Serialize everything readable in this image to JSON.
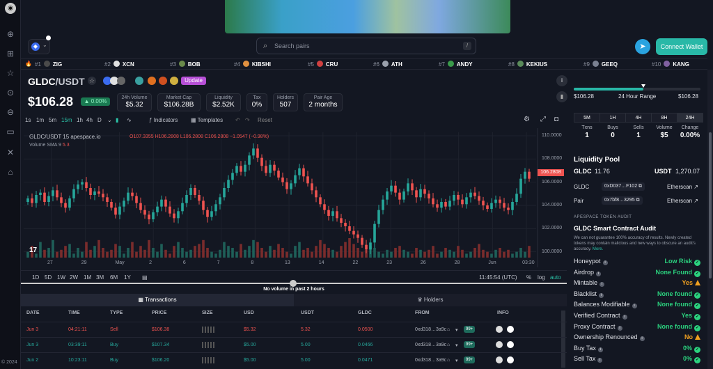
{
  "sidebar": {
    "icons": [
      "ape-logo-icon",
      "globe-icon",
      "dashboard-icon",
      "star-icon",
      "upload-icon",
      "download-icon",
      "archive-icon",
      "tools-icon",
      "graduation-icon"
    ],
    "copyright": "© 2024"
  },
  "header": {
    "search_placeholder": "Search pairs",
    "search_shortcut": "/",
    "connect_wallet": "Connect Wallet"
  },
  "trending": [
    {
      "rank": "#1",
      "symbol": "ZIG"
    },
    {
      "rank": "#2",
      "symbol": "XCN"
    },
    {
      "rank": "#3",
      "symbol": "BOB"
    },
    {
      "rank": "#4",
      "symbol": "KIBSHI"
    },
    {
      "rank": "#5",
      "symbol": "CRU"
    },
    {
      "rank": "#6",
      "symbol": "ATH"
    },
    {
      "rank": "#7",
      "symbol": "ANDY"
    },
    {
      "rank": "#8",
      "symbol": "KEKIUS"
    },
    {
      "rank": "#9",
      "symbol": "GEEQ"
    },
    {
      "rank": "#10",
      "symbol": "KANG"
    }
  ],
  "pair": {
    "base": "GLDC",
    "quote": "/USDT",
    "update_label": "Update",
    "price": "$106.28",
    "change": "0.00%",
    "stats": [
      {
        "label": "24h Volume",
        "value": "$5.32"
      },
      {
        "label": "Market Cap",
        "value": "$106.28B"
      },
      {
        "label": "Liquidity",
        "value": "$2.52K"
      },
      {
        "label": "Tax",
        "value": "0%"
      },
      {
        "label": "Holders",
        "value": "507"
      },
      {
        "label": "Pair Age",
        "value": "2 months"
      }
    ]
  },
  "chart_tools": {
    "timeframes": [
      "1s",
      "1m",
      "5m",
      "15m",
      "1h",
      "4h",
      "D"
    ],
    "active": "15m",
    "indicators": "Indicators",
    "templates": "Templates",
    "reset": "Reset"
  },
  "chart_data": {
    "type": "candlestick",
    "legend": "GLDC/USDT  15  apespace.io",
    "ohlc": {
      "o": "O107.3355",
      "h": "H106.2808",
      "l": "L106.2808",
      "c": "C106.2808",
      "chg": "−1.0547 (−0.98%)"
    },
    "volume_legend": "Volume SMA 9",
    "volume_value": "5.3",
    "y_ticks": [
      "110.0000",
      "108.0000",
      "106.0000",
      "104.0000",
      "102.0000",
      "100.0000"
    ],
    "last_price_tag": "106.2808",
    "x_ticks": [
      "27",
      "29",
      "May",
      "2",
      "6",
      "7",
      "8",
      "13",
      "14",
      "22",
      "23",
      "26",
      "28",
      "Jun",
      "03:30"
    ],
    "ylim": [
      99.5,
      110.3
    ],
    "close_series": [
      104.6,
      104.2,
      104.9,
      105.1,
      104.3,
      104.8,
      105.3,
      104.7,
      104.2,
      103.8,
      104.6,
      105.4,
      105.8,
      106.0,
      105.5,
      104.9,
      105.2,
      105.0,
      104.7,
      104.3,
      103.8,
      103.2,
      103.9,
      104.4,
      105.1,
      104.8,
      104.2,
      103.6,
      103.2,
      102.8,
      103.4,
      103.9,
      104.5,
      103.9,
      103.3,
      102.9,
      103.5,
      104.2,
      104.9,
      105.5,
      104.9,
      104.4,
      103.6,
      103.0,
      103.5,
      104.1,
      104.7,
      105.5,
      106.2,
      106.8,
      107.4,
      106.9,
      107.5,
      108.3,
      108.9,
      108.1,
      107.4,
      106.8,
      107.5,
      107.0,
      106.4,
      106.0,
      105.4,
      105.9,
      106.6,
      107.2,
      106.5,
      105.9,
      105.3,
      104.7,
      104.1,
      103.6,
      103.1,
      103.5,
      102.9,
      102.5,
      102.2,
      101.8,
      101.5,
      101.2,
      100.6,
      100.2,
      100.8,
      102.4,
      103.6,
      104.5,
      105.2,
      105.7,
      105.1,
      104.5,
      105.2,
      105.9,
      105.3,
      104.7,
      105.4,
      105.0,
      104.6,
      104.1,
      103.8,
      104.3,
      103.9,
      104.4,
      104.9,
      104.5,
      104.1,
      104.7,
      105.1,
      104.8,
      104.4,
      104.0,
      103.7,
      104.2,
      104.5,
      104.2,
      103.8,
      103.6,
      104.3,
      105.0,
      106.3,
      106.9,
      106.3
    ],
    "volume_series": [
      3,
      6,
      2,
      8,
      4,
      5,
      9,
      3,
      4,
      6,
      7,
      2,
      5,
      3,
      8,
      4,
      6,
      9,
      5,
      3,
      4,
      7,
      6,
      2,
      5,
      8,
      3,
      6,
      4,
      9,
      5,
      3,
      7,
      4,
      2,
      6,
      8,
      5,
      3,
      4,
      6,
      7,
      9,
      5,
      3,
      2,
      4,
      8,
      6,
      5,
      3,
      7,
      4,
      6,
      9,
      8,
      5,
      3,
      6,
      4,
      7,
      5,
      3,
      2,
      6,
      8,
      4,
      5,
      3,
      6,
      9,
      7,
      5,
      4,
      3,
      6,
      8,
      10,
      7,
      5,
      3,
      4,
      6,
      5,
      3,
      2,
      4,
      3,
      5,
      6,
      4,
      3,
      2,
      5,
      4,
      3,
      4,
      6,
      2,
      3,
      5,
      4,
      3,
      6,
      4,
      2,
      3,
      5,
      7,
      4,
      3,
      2,
      4,
      5,
      3,
      4,
      2,
      3,
      5
    ],
    "xlabel": "",
    "ylabel": ""
  },
  "range_bar": {
    "ranges": [
      "1D",
      "5D",
      "1W",
      "2W",
      "1M",
      "3M",
      "6M",
      "1Y"
    ],
    "time": "11:45:54 (UTC)",
    "pct": "%",
    "log": "log",
    "auto": "auto"
  },
  "no_volume": "No volume in past 2 hours",
  "tabs": {
    "transactions": "Transactions",
    "holders": "Holders"
  },
  "table": {
    "headers": [
      "DATE",
      "TIME",
      "TYPE",
      "PRICE",
      "SIZE",
      "USD",
      "USDT",
      "GLDC",
      "FROM",
      "INFO"
    ],
    "rows": [
      {
        "date": "Jun 3",
        "time": "04:21:11",
        "type": "Sell",
        "price": "$106.38",
        "usd": "$5.32",
        "usdt": "5.32",
        "gldc": "0.0500",
        "from": "0xd318…3a9c",
        "badge": "99+"
      },
      {
        "date": "Jun 3",
        "time": "03:39:11",
        "type": "Buy",
        "price": "$107.34",
        "usd": "$5.00",
        "usdt": "5.00",
        "gldc": "0.0466",
        "from": "0xd318…3a9c",
        "badge": "99+"
      },
      {
        "date": "Jun 2",
        "time": "10:23:11",
        "type": "Buy",
        "price": "$106.20",
        "usd": "$5.00",
        "usdt": "5.00",
        "gldc": "0.0471",
        "from": "0xd318…3a9c",
        "badge": "99+"
      }
    ]
  },
  "right_panel": {
    "range_low": "$106.28",
    "range_label": "24 Hour Range",
    "range_high": "$106.28",
    "range_marker_pct": 0.55,
    "periods": [
      "5M",
      "1H",
      "4H",
      "8H",
      "24H"
    ],
    "active_period": "24H",
    "txn_stats": [
      {
        "label": "Txns",
        "value": "1"
      },
      {
        "label": "Buys",
        "value": "0"
      },
      {
        "label": "Sells",
        "value": "1"
      },
      {
        "label": "Volume",
        "value": "$5"
      },
      {
        "label": "Change",
        "value": "0.00%"
      }
    ],
    "liquidity_title": "Liquidity Pool",
    "lp_base_label": "GLDC",
    "lp_base_value": "11.76",
    "lp_quote_label": "USDT",
    "lp_quote_value": "1,270.07",
    "gldc_label": "GLDC",
    "gldc_addr": "0xD037…F102",
    "gldc_link": "Etherscan",
    "pair_label": "Pair",
    "pair_addr": "0x7bf8…3295",
    "pair_link": "Etherscan",
    "audit_section": "APESPACE TOKEN AUDIT",
    "audit_title": "GLDC Smart Contract Audit",
    "audit_disclaimer": "We can not guarantee 100% accuracy of results. Newly created tokens may contain malicious and new ways to obscure an audit's accuracy.",
    "audit_more": "More.",
    "audit_items": [
      {
        "label": "Honeypot",
        "value": "Low Risk",
        "status": "ok"
      },
      {
        "label": "Airdrop",
        "value": "None Found",
        "status": "ok"
      },
      {
        "label": "Mintable",
        "value": "Yes",
        "status": "warn"
      },
      {
        "label": "Blacklist",
        "value": "None found",
        "status": "ok"
      },
      {
        "label": "Balances Modifiable",
        "value": "None found",
        "status": "ok"
      },
      {
        "label": "Verified Contract",
        "value": "Yes",
        "status": "ok"
      },
      {
        "label": "Proxy Contract",
        "value": "None found",
        "status": "ok"
      },
      {
        "label": "Ownership Renounced",
        "value": "No",
        "status": "warn"
      },
      {
        "label": "Buy Tax",
        "value": "0%",
        "status": "ok"
      },
      {
        "label": "Sell Tax",
        "value": "0%",
        "status": "ok"
      }
    ]
  },
  "colors": {
    "up": "#26a69a",
    "down": "#ef5350",
    "accent": "#29b8a7"
  }
}
